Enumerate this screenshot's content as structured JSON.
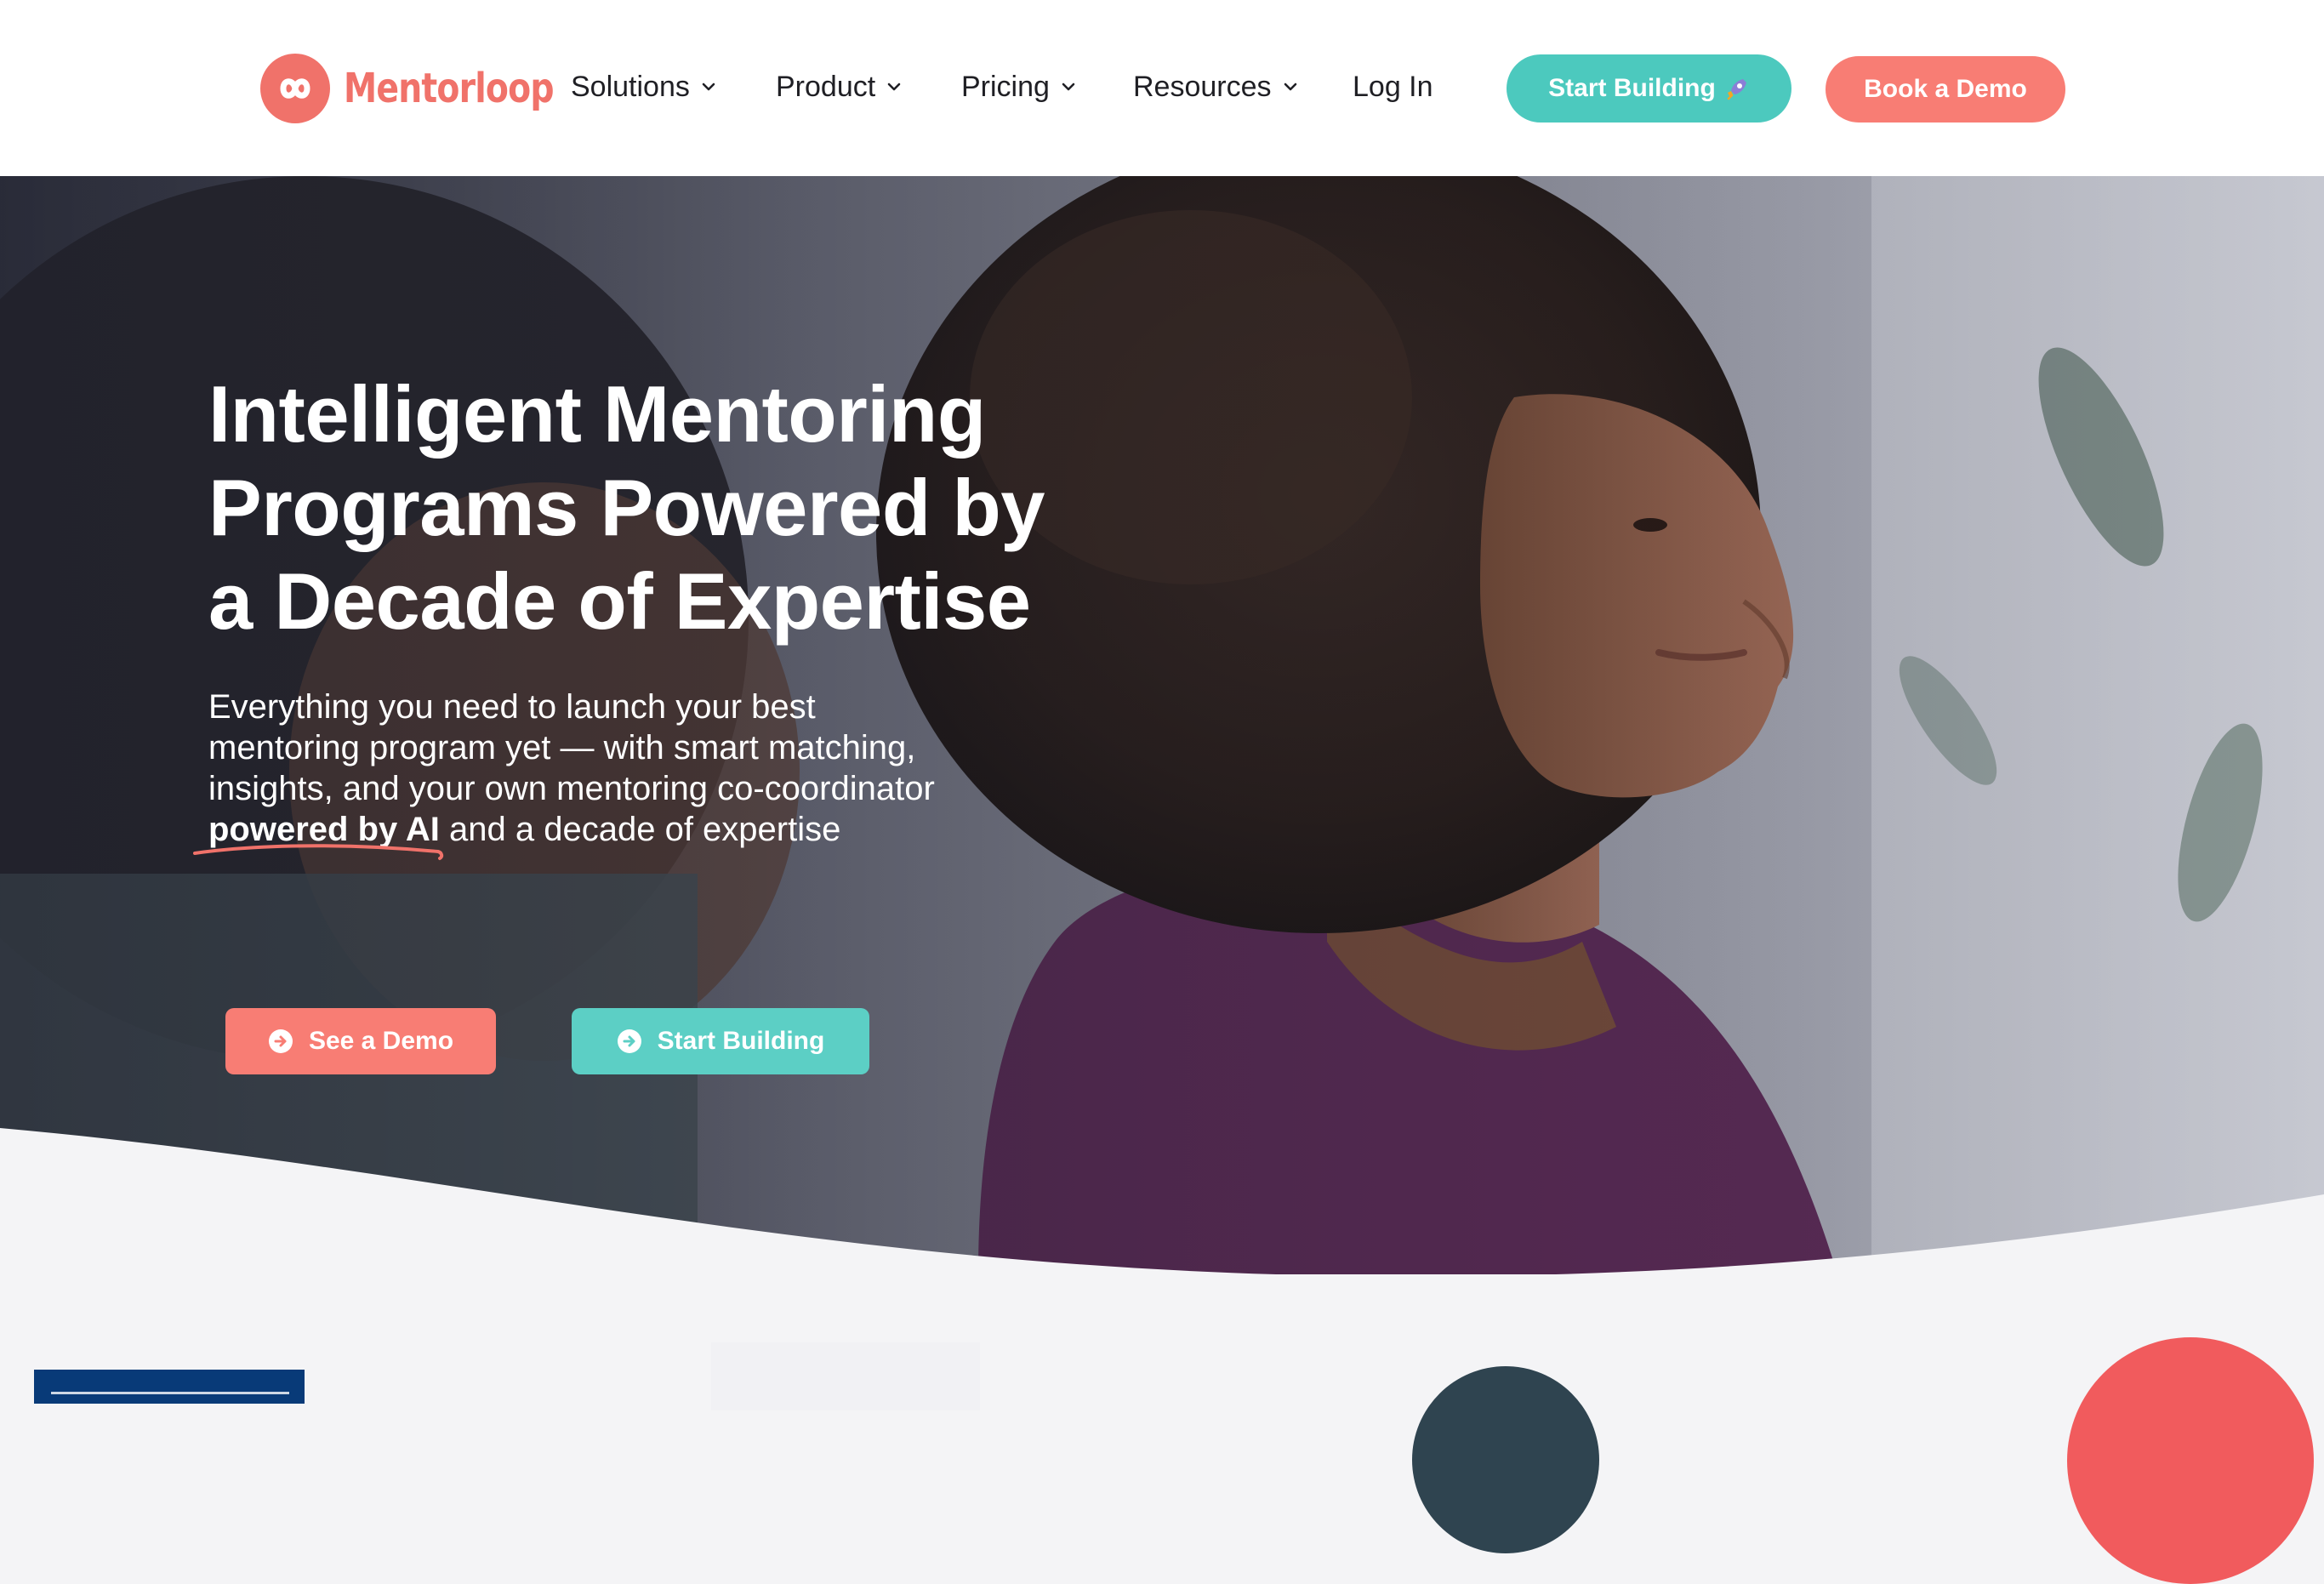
{
  "header": {
    "logo_text": "Mentorloop",
    "nav": [
      {
        "label": "Solutions",
        "has_dropdown": true
      },
      {
        "label": "Product",
        "has_dropdown": true
      },
      {
        "label": "Pricing",
        "has_dropdown": true
      },
      {
        "label": "Resources",
        "has_dropdown": true
      },
      {
        "label": "Log In",
        "has_dropdown": false
      }
    ],
    "start_building_label": "Start Building",
    "start_building_icon": "rocket-icon",
    "book_demo_label": "Book a Demo"
  },
  "hero": {
    "title_line1": "Intelligent Mentoring",
    "title_line2": "Programs Powered by",
    "title_line3": "a Decade of Expertise",
    "subtitle_line1": "Everything you need to launch your best",
    "subtitle_line2": "mentoring program yet — with smart matching,",
    "subtitle_line3": "insights, and your own mentoring co-coordinator",
    "subtitle_emphasis": "powered by AI",
    "subtitle_tail": " and a decade of expertise",
    "cta_demo_label": "See a Demo",
    "cta_start_label": "Start Building"
  },
  "colors": {
    "brand_coral": "#f0726a",
    "button_coral": "#f87d74",
    "brand_teal": "#4cc9be",
    "page_bg": "#f4f4f6"
  }
}
